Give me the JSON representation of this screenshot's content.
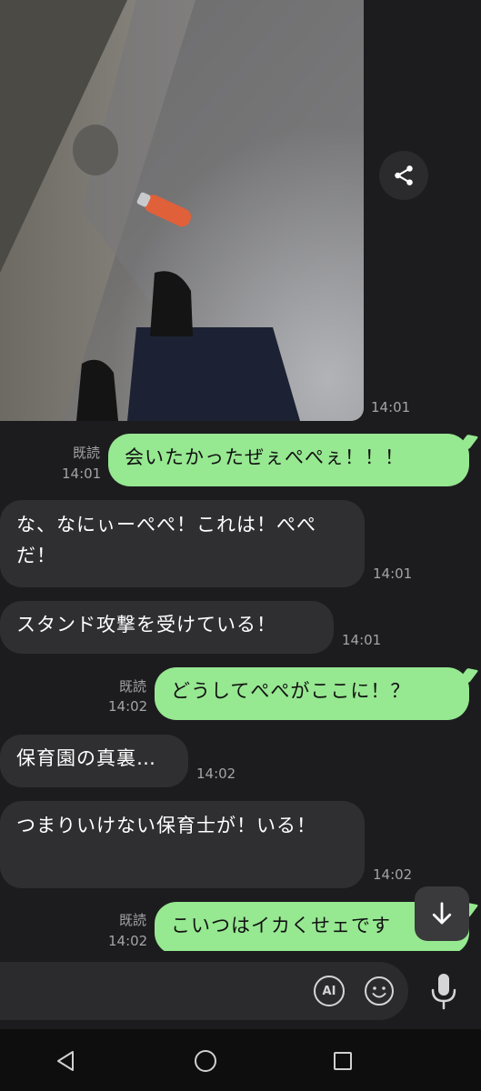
{
  "photo_message": {
    "time": "14:01"
  },
  "messages": [
    {
      "side": "out",
      "read": "既読",
      "time": "14:01",
      "text": "会いたかったぜぇぺぺぇ！！！"
    },
    {
      "side": "in",
      "time": "14:01",
      "text": "な、なにぃーぺぺ！これは！ぺぺだ！"
    },
    {
      "side": "in",
      "time": "14:01",
      "text": "スタンド攻撃を受けている！"
    },
    {
      "side": "out",
      "read": "既読",
      "time": "14:02",
      "text": "どうしてぺぺがここに！？"
    },
    {
      "side": "in",
      "time": "14:02",
      "text": "保育園の真裏…"
    },
    {
      "side": "in",
      "time": "14:02",
      "text": "つまりいけない保育士が！いる！"
    },
    {
      "side": "out",
      "read": "既読",
      "time": "14:02",
      "text": "こいつはイカくせェです"
    }
  ],
  "input": {
    "value": "",
    "placeholder": ""
  },
  "ai_label": "AI",
  "icons": {
    "share": "share-icon",
    "scroll_down": "arrow-down-icon",
    "emoji": "emoji-icon",
    "mic": "microphone-icon",
    "nav_back": "back-triangle-icon",
    "nav_home": "home-circle-icon",
    "nav_recents": "recents-square-icon"
  },
  "colors": {
    "background": "#1c1c1e",
    "outgoing_bubble": "#96e891",
    "incoming_bubble": "#2f2f31"
  }
}
